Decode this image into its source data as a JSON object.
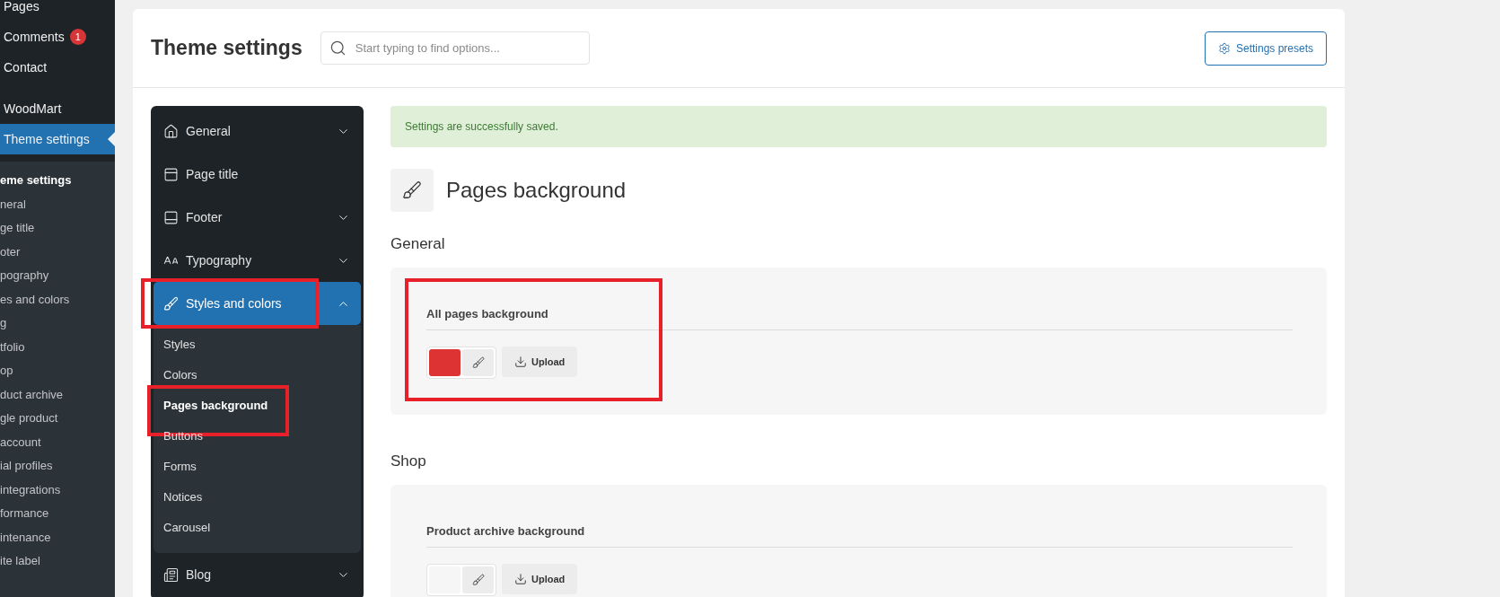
{
  "admin_menu": {
    "groups": [
      {
        "items": [
          {
            "label": "Pages",
            "selected": false
          },
          {
            "label": "Comments",
            "badge": "1",
            "selected": false
          },
          {
            "label": "Contact",
            "selected": false
          }
        ]
      },
      {
        "items": [
          {
            "label": "WoodMart",
            "selected": false
          },
          {
            "label": "Theme settings",
            "selected": true
          }
        ]
      }
    ],
    "submenu": {
      "title": "eme settings",
      "items": [
        {
          "label": "neral"
        },
        {
          "label": "ge title"
        },
        {
          "label": "oter"
        },
        {
          "label": "pography"
        },
        {
          "label": "es and colors"
        },
        {
          "label": "g"
        },
        {
          "label": "tfolio"
        },
        {
          "label": "op"
        },
        {
          "label": "duct archive"
        },
        {
          "label": "gle product"
        },
        {
          "label": "account"
        },
        {
          "label": "ial profiles"
        },
        {
          "label": "integrations"
        },
        {
          "label": "formance"
        },
        {
          "label": "intenance"
        },
        {
          "label": "ite label"
        }
      ]
    }
  },
  "header": {
    "title": "Theme settings",
    "search": {
      "placeholder": "Start typing to find options..."
    },
    "presets_button": "Settings presets"
  },
  "settings_nav": {
    "items": [
      {
        "label": "General",
        "expandable": true,
        "expanded": false,
        "selected": false,
        "highlighted": false
      },
      {
        "label": "Page title",
        "expandable": false,
        "expanded": false,
        "selected": false,
        "highlighted": false
      },
      {
        "label": "Footer",
        "expandable": true,
        "expanded": false,
        "selected": false,
        "highlighted": false
      },
      {
        "label": "Typography",
        "expandable": true,
        "expanded": false,
        "selected": false,
        "highlighted": false
      },
      {
        "label": "Styles and colors",
        "expandable": true,
        "expanded": true,
        "selected": true,
        "highlighted": true,
        "children": [
          {
            "label": "Styles",
            "selected": false,
            "highlighted": false
          },
          {
            "label": "Colors",
            "selected": false,
            "highlighted": false
          },
          {
            "label": "Pages background",
            "selected": true,
            "highlighted": true
          },
          {
            "label": "Buttons",
            "selected": false,
            "highlighted": false
          },
          {
            "label": "Forms",
            "selected": false,
            "highlighted": false
          },
          {
            "label": "Notices",
            "selected": false,
            "highlighted": false
          },
          {
            "label": "Carousel",
            "selected": false,
            "highlighted": false
          }
        ]
      },
      {
        "label": "Blog",
        "expandable": true,
        "expanded": false,
        "selected": false,
        "highlighted": false
      }
    ]
  },
  "notice": "Settings are successfully saved.",
  "section": {
    "title": "Pages background",
    "groups": [
      {
        "title": "General",
        "options": [
          {
            "label": "All pages background",
            "color": "#dd3333",
            "upload": "Upload",
            "highlighted": true
          }
        ]
      },
      {
        "title": "Shop",
        "options": [
          {
            "label": "Product archive background",
            "upload": "Upload",
            "highlighted": false
          }
        ]
      }
    ]
  }
}
